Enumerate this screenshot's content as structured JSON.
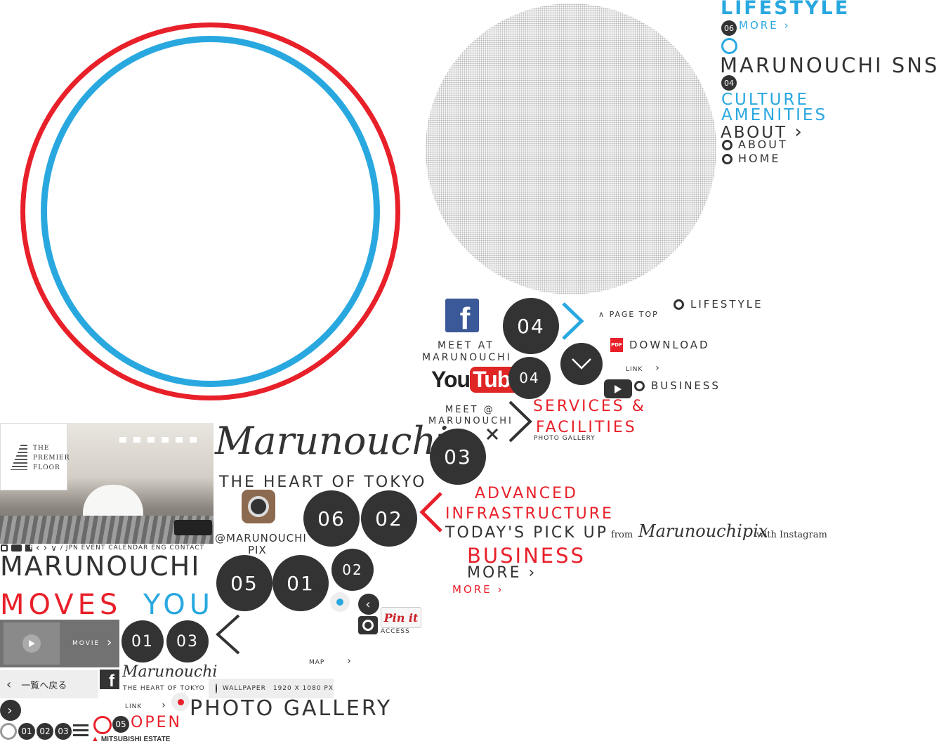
{
  "nav_right": {
    "lifestyle": "LIFESTYLE",
    "more_1": "MORE",
    "num_06": "06",
    "sns": "MARUNOUCHI SNS",
    "num_04": "04",
    "culture": "CULTURE",
    "amenities": "AMENITIES",
    "about_arrow": "ABOUT",
    "about": "ABOUT",
    "home": "HOME"
  },
  "mid": {
    "meet_at": "MEET AT",
    "marunouchi": "MARUNOUCHI",
    "youtube_you": "You",
    "youtube_tube": "Tube",
    "circle_04a": "04",
    "circle_04b": "04",
    "page_top": "PAGE TOP",
    "lifestyle": "LIFESTYLE",
    "download": "DOWNLOAD",
    "pdf": "PDF",
    "link": "LINK",
    "business": "BUSINESS",
    "meet_at_2": "MEET @",
    "marunouchi_2": "MARUNOUCHI",
    "services": "SERVICES &",
    "facilities": "FACILITIES",
    "photo_gallery_small": "PHOTO GALLERY",
    "circle_03": "03",
    "script_title": "Marunouchi",
    "heart": "THE HEART OF TOKYO",
    "circle_06": "06",
    "circle_02": "02",
    "advanced": "ADVANCED",
    "infrastructure": "INFRASTRUCTURE",
    "todays": "TODAY'S PICK UP",
    "from": "from",
    "pix_script": "Marunouchipix",
    "with_instagram": "with Instagram",
    "at_marunouchi": "@MARUNOUCHI",
    "pix": "PIX",
    "business_big": "BUSINESS",
    "more_big": "MORE",
    "more_red": "MORE",
    "circle_05": "05",
    "circle_01": "01",
    "circle_02b": "02",
    "pinit": "Pin it",
    "access": "ACCESS",
    "map": "MAP"
  },
  "left": {
    "premier_1": "THE",
    "premier_2": "PREMIER",
    "premier_3": "FLOOR",
    "sub_nav": "/ JPN EVENT  CALENDAR ENG CONTACT",
    "marunouchi": "MARUNOUCHI",
    "moves": "MOVES",
    "you": "YOU",
    "movie": "MOVIE",
    "circle_01": "01",
    "circle_03": "03",
    "back": "一覧へ戻る",
    "script_small": "Marunouchi",
    "heart_small": "THE HEART OF TOKYO",
    "wallpaper": "WALLPAPER",
    "wallpaper_size": "1920 X 1080 PX",
    "link": "LINK",
    "photo_gallery": "PHOTO GALLERY",
    "pag_01": "01",
    "pag_02": "02",
    "pag_03": "03",
    "pag_05": "05",
    "open": "OPEN",
    "mitsubishi": "MITSUBISHI ESTATE"
  },
  "colors": {
    "red": "#e8202a",
    "blue": "#29a8e0",
    "dark": "#333333",
    "facebook": "#3b5998"
  }
}
